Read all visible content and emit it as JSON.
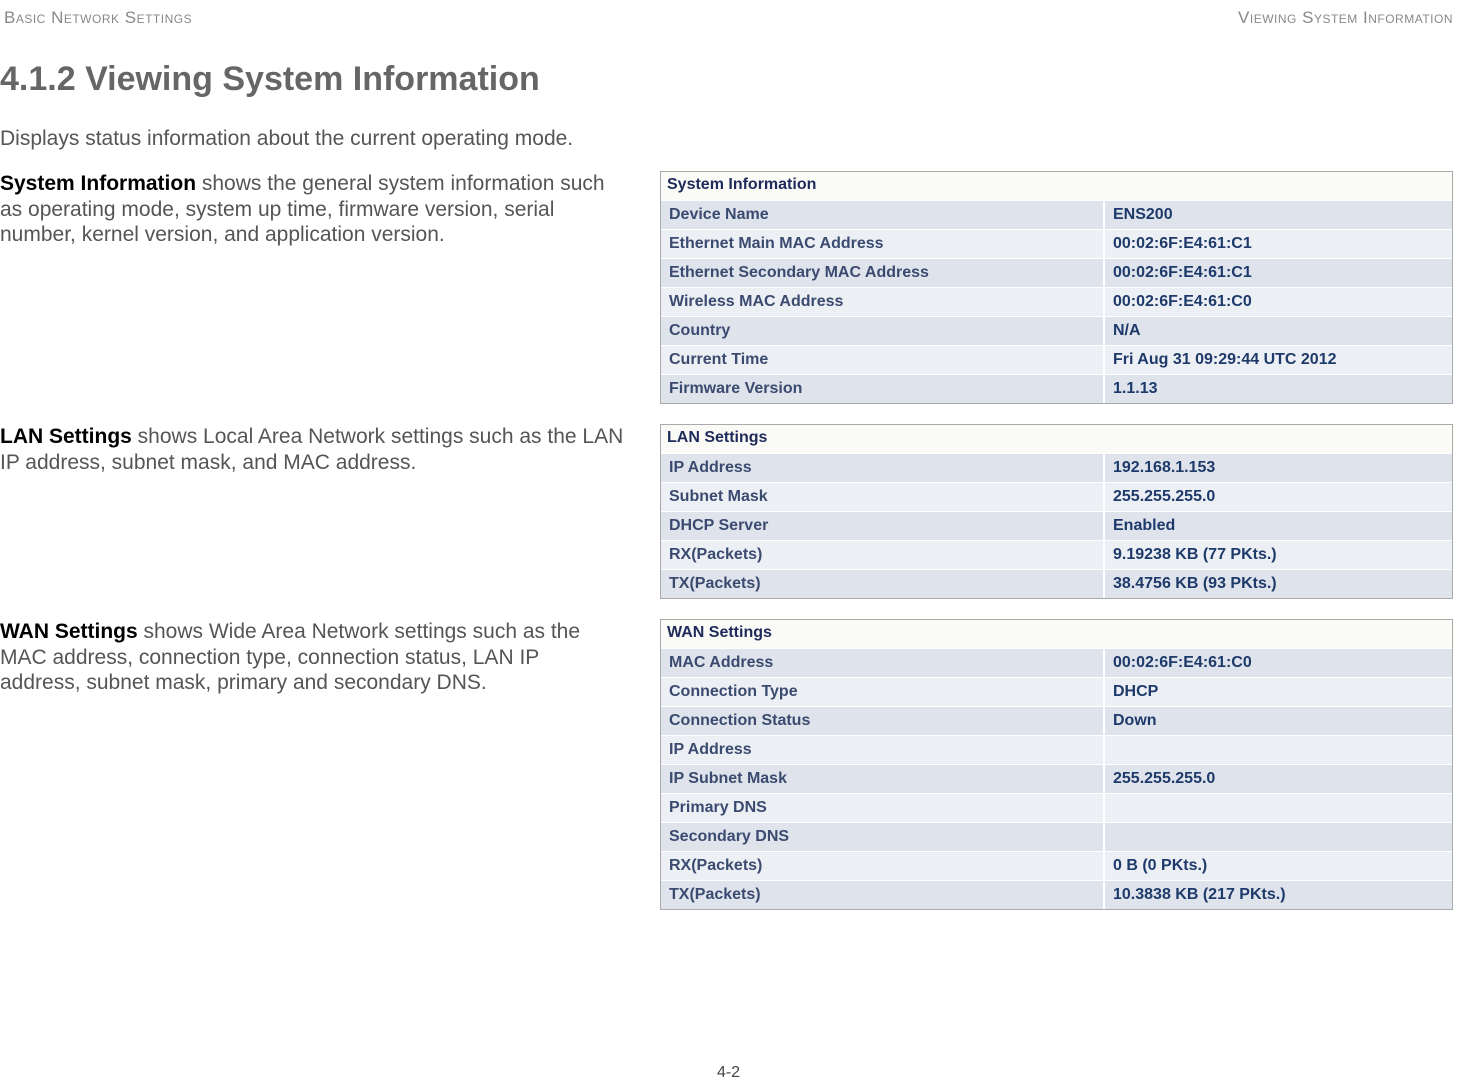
{
  "header": {
    "left": "Basic Network Settings",
    "right": "Viewing System Information"
  },
  "title": "4.1.2 Viewing System Information",
  "intro": "Displays status information about the current operating mode.",
  "sections": [
    {
      "desc_bold": "System Information",
      "desc_rest": "  shows the general system information such as operating mode, system up time, firmware version, serial number, kernel version, and application version.",
      "panel_title": "System Information",
      "rows": [
        {
          "label": "Device Name",
          "value": "ENS200"
        },
        {
          "label": "Ethernet Main MAC Address",
          "value": "00:02:6F:E4:61:C1"
        },
        {
          "label": "Ethernet Secondary MAC Address",
          "value": "00:02:6F:E4:61:C1"
        },
        {
          "label": "Wireless MAC Address",
          "value": "00:02:6F:E4:61:C0"
        },
        {
          "label": "Country",
          "value": "N/A"
        },
        {
          "label": "Current Time",
          "value": "Fri Aug 31 09:29:44 UTC 2012"
        },
        {
          "label": "Firmware Version",
          "value": "1.1.13"
        }
      ]
    },
    {
      "desc_bold": "LAN Settings",
      "desc_rest": "  shows Local Area Network settings such as the LAN IP address, subnet mask, and MAC address.",
      "panel_title": "LAN Settings",
      "rows": [
        {
          "label": "IP Address",
          "value": "192.168.1.153"
        },
        {
          "label": "Subnet Mask",
          "value": "255.255.255.0"
        },
        {
          "label": "DHCP Server",
          "value": "Enabled"
        },
        {
          "label": "RX(Packets)",
          "value": "9.19238 KB (77 PKts.)"
        },
        {
          "label": "TX(Packets)",
          "value": "38.4756 KB (93 PKts.)"
        }
      ]
    },
    {
      "desc_bold": "WAN Settings",
      "desc_rest": "  shows Wide Area Network settings such as the MAC address, connection type, connection status, LAN IP address, subnet mask, primary and secondary DNS.",
      "panel_title": "WAN Settings",
      "rows": [
        {
          "label": "MAC Address",
          "value": "00:02:6F:E4:61:C0"
        },
        {
          "label": "Connection Type",
          "value": "DHCP"
        },
        {
          "label": "Connection Status",
          "value": "Down"
        },
        {
          "label": "IP Address",
          "value": ""
        },
        {
          "label": "IP Subnet Mask",
          "value": "255.255.255.0"
        },
        {
          "label": "Primary DNS",
          "value": ""
        },
        {
          "label": "Secondary DNS",
          "value": ""
        },
        {
          "label": "RX(Packets)",
          "value": "0 B (0 PKts.)"
        },
        {
          "label": "TX(Packets)",
          "value": "10.3838 KB (217 PKts.)"
        }
      ]
    }
  ],
  "pagenum": "4-2"
}
